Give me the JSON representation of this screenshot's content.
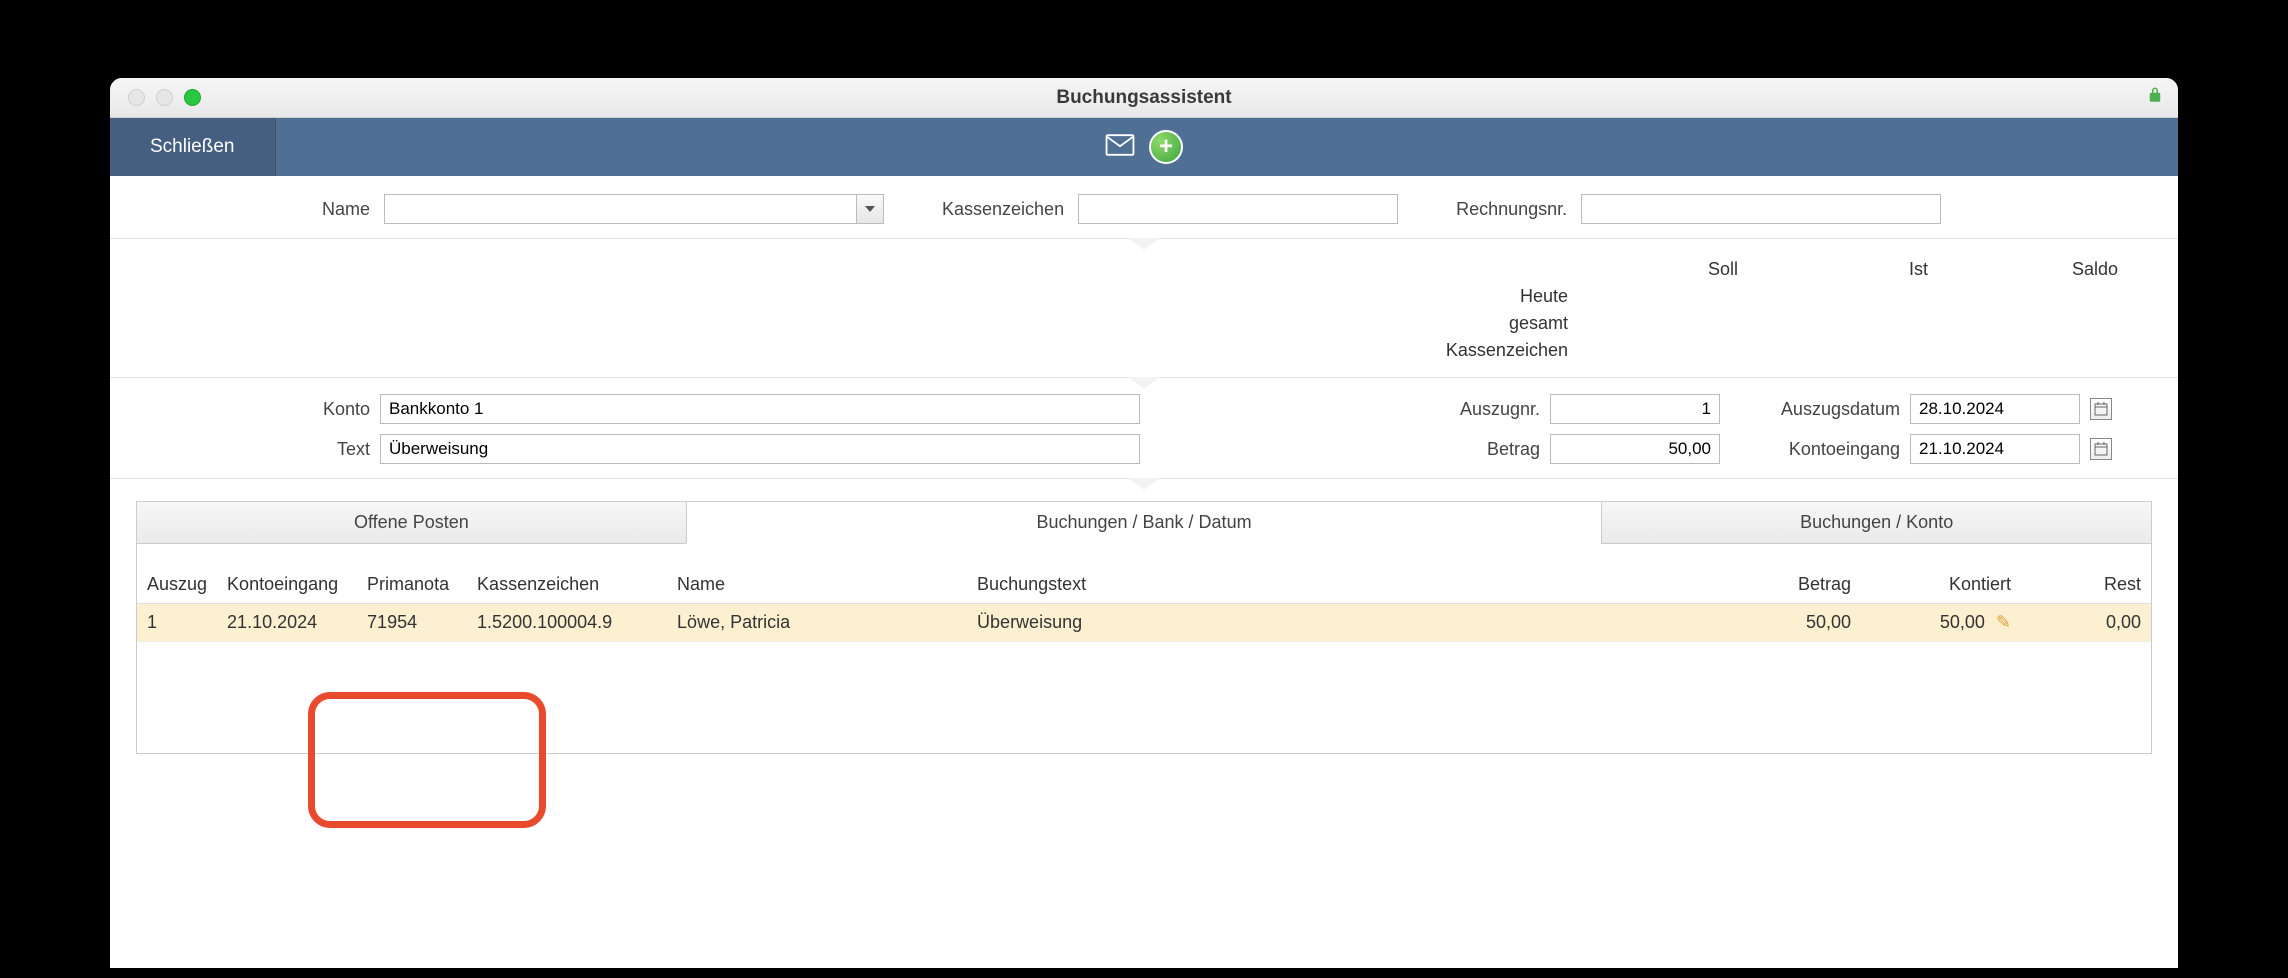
{
  "window": {
    "title": "Buchungsassistent"
  },
  "toolbar": {
    "close_label": "Schließen"
  },
  "filters": {
    "name_label": "Name",
    "name_value": "",
    "kassenzeichen_label": "Kassenzeichen",
    "kassenzeichen_value": "",
    "rechnungsnr_label": "Rechnungsnr.",
    "rechnungsnr_value": ""
  },
  "summary": {
    "col_soll": "Soll",
    "col_ist": "Ist",
    "col_saldo": "Saldo",
    "rows": [
      {
        "label": "Heute"
      },
      {
        "label": "gesamt"
      },
      {
        "label": "Kassenzeichen"
      }
    ]
  },
  "form": {
    "konto_label": "Konto",
    "konto_value": "Bankkonto 1",
    "text_label": "Text",
    "text_value": "Überweisung",
    "auszugnr_label": "Auszugnr.",
    "auszugnr_value": "1",
    "betrag_label": "Betrag",
    "betrag_value": "50,00",
    "auszugsdatum_label": "Auszugsdatum",
    "auszugsdatum_value": "28.10.2024",
    "kontoeingang_label": "Kontoeingang",
    "kontoeingang_value": "21.10.2024"
  },
  "tabs": {
    "offene_posten": "Offene Posten",
    "buchungen_bank": "Buchungen / Bank / Datum",
    "buchungen_konto": "Buchungen / Konto"
  },
  "table": {
    "headers": {
      "auszug": "Auszug",
      "kontoeingang": "Kontoeingang",
      "primanota": "Primanota",
      "kassenzeichen": "Kassenzeichen",
      "name": "Name",
      "buchungstext": "Buchungstext",
      "betrag": "Betrag",
      "kontiert": "Kontiert",
      "rest": "Rest"
    },
    "rows": [
      {
        "auszug": "1",
        "kontoeingang": "21.10.2024",
        "primanota": "71954",
        "kassenzeichen": "1.5200.100004.9",
        "name": "Löwe, Patricia",
        "buchungstext": "Überweisung",
        "betrag": "50,00",
        "kontiert": "50,00",
        "rest": "0,00"
      }
    ]
  }
}
